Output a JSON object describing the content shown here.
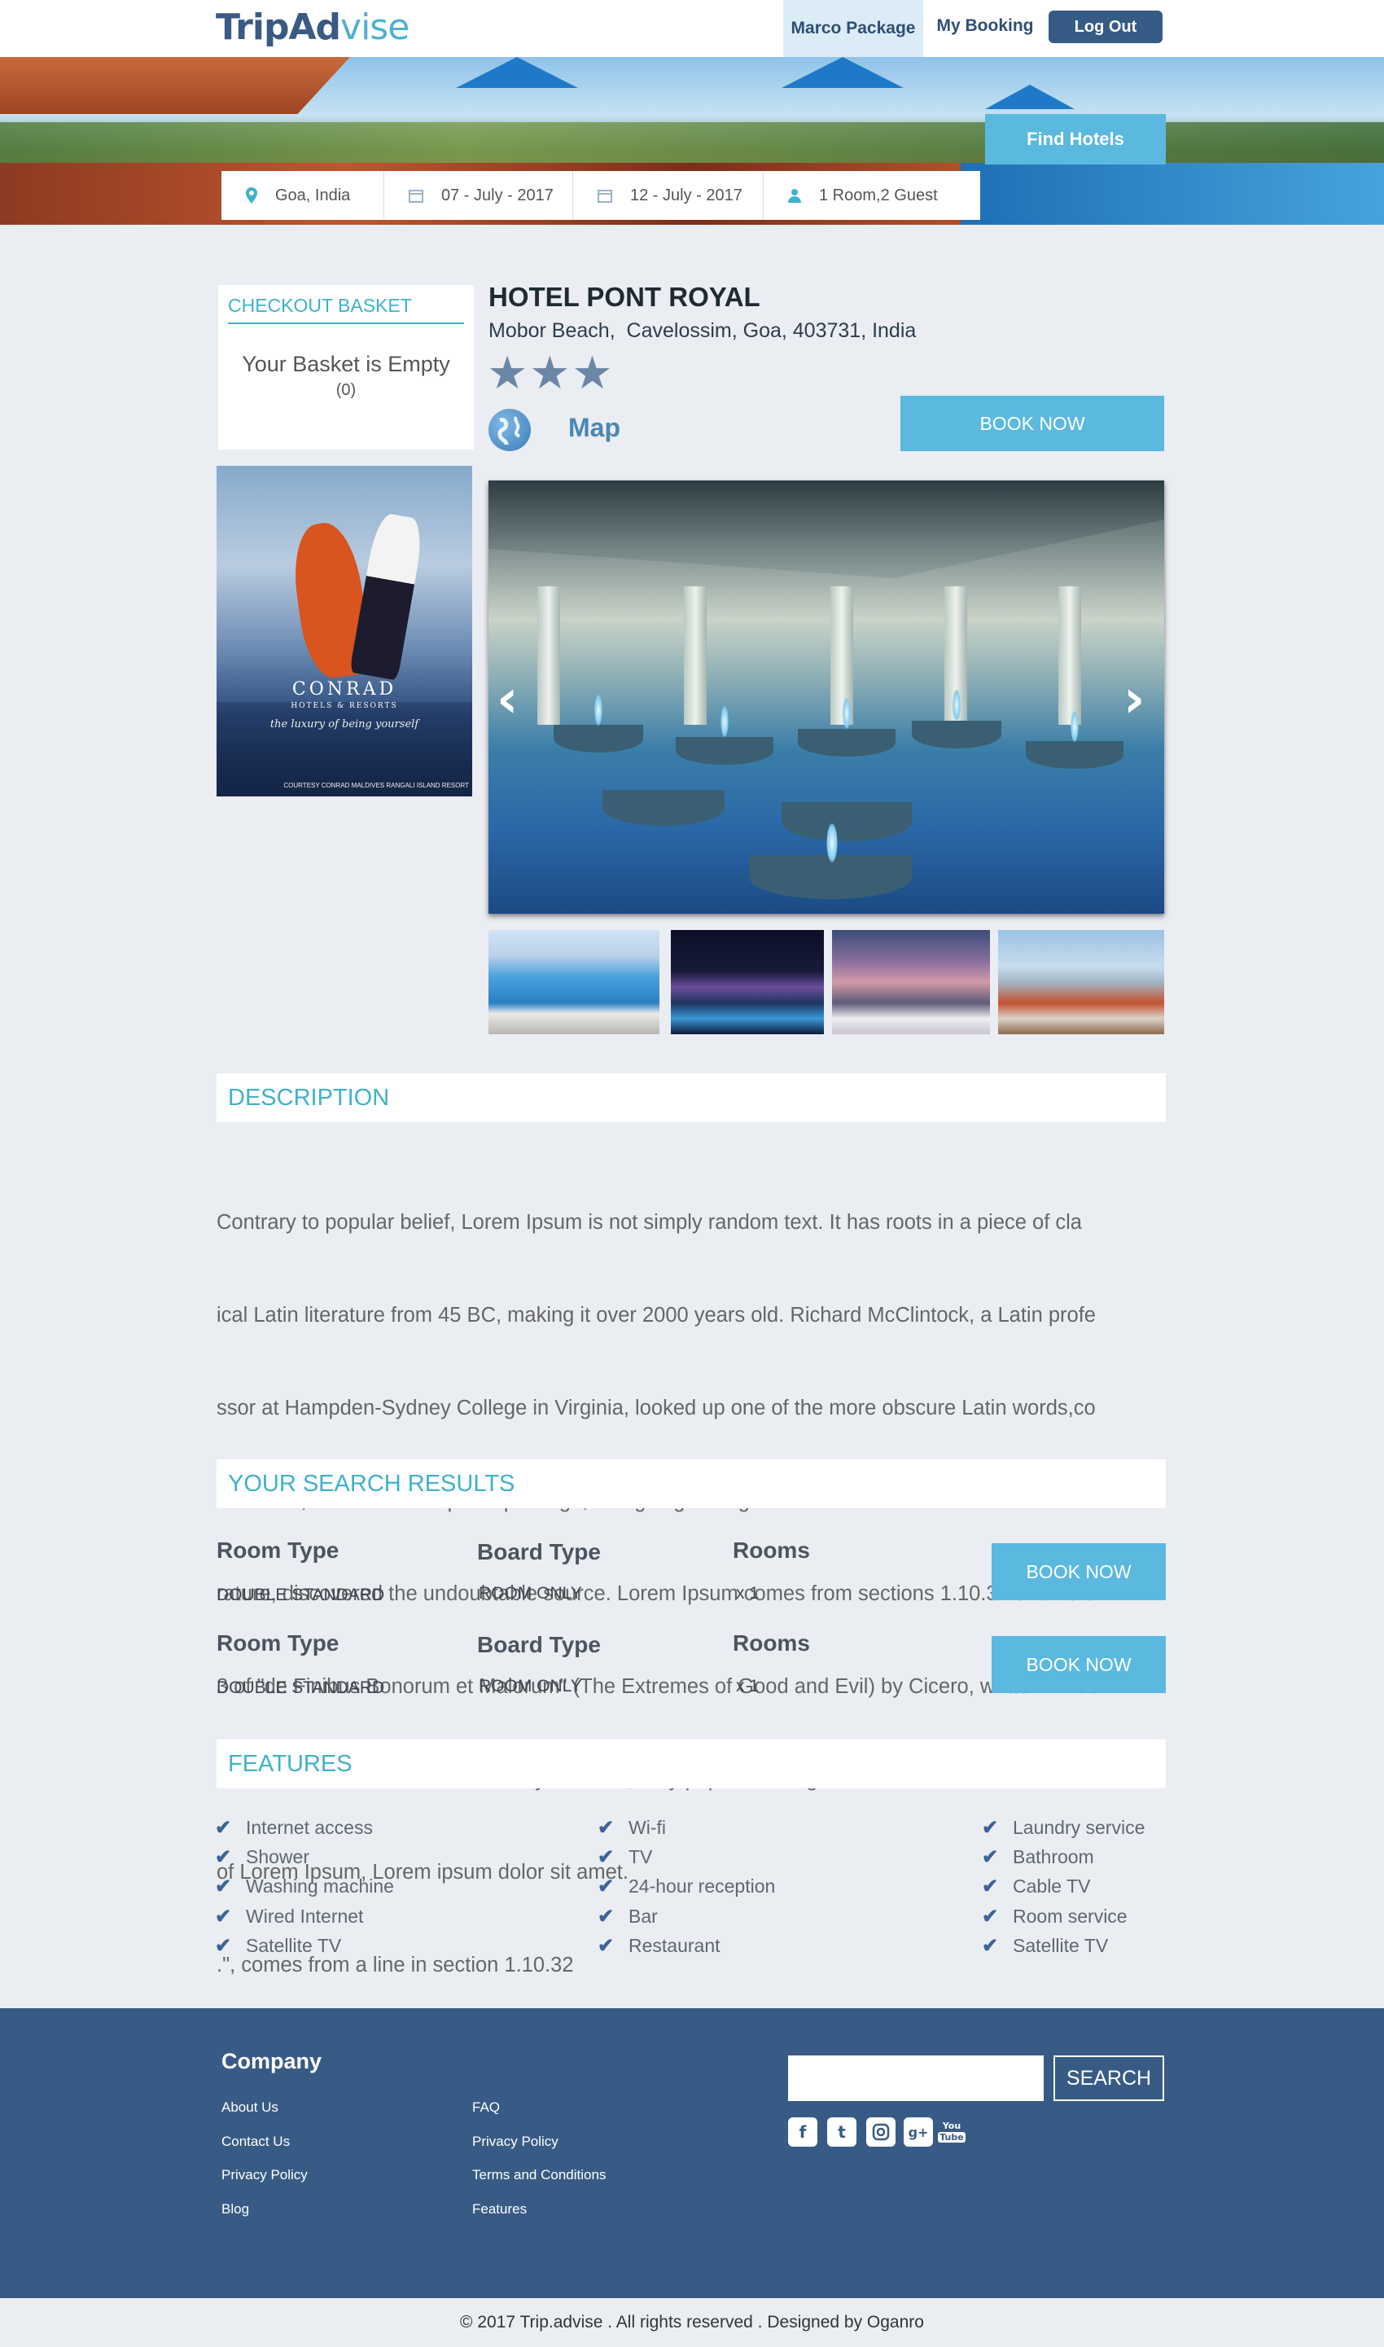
{
  "header": {
    "logo_part1": "TripAd",
    "logo_part2": "v",
    "logo_part3": "ise",
    "nav_marco": "Marco Package",
    "nav_booking": "My Booking",
    "nav_logout": "Log Out"
  },
  "search": {
    "location": "Goa, India",
    "checkin": "07 - July - 2017",
    "checkout": "12 - July - 2017",
    "guests": "1 Room,2 Guest",
    "button": "Find  Hotels"
  },
  "basket": {
    "title": "CHECKOUT BASKET",
    "empty": "Your Basket is Empty",
    "count": "(0)"
  },
  "promo": {
    "brand": "CONRAD",
    "sub": "HOTELS & RESORTS",
    "tagline": "the luxury of being yourself",
    "credit": "COURTESY CONRAD MALDIVES RANGALI ISLAND RESORT"
  },
  "hotel": {
    "name": "HOTEL PONT ROYAL",
    "address": "Mobor Beach,  Cavelossim, Goa, 403731, India",
    "stars": 3,
    "map_label": "Map",
    "book_label": "BOOK NOW"
  },
  "description": {
    "title": "DESCRIPTION",
    "lines": [
      "Contrary to popular belief, Lorem Ipsum is not simply random text. It has roots in a piece of cla",
      "ical Latin literature from 45 BC, making it over 2000 years old. Richard McClintock, a Latin profe",
      "ssor at Hampden-Sydney College in Virginia, looked up one of the more obscure Latin words,co",
      "nsectetur, from a Lorem Ipsum passage, and going through the cites of the word in classical lite",
      "rature, discovered the undoubtable source. Lorem Ipsum comes from sections 1.10.32 and 10.3",
      "3 of \"de Finibus Bonorum et Malorum\" (The Extremes of Good and Evil) by Cicero, writtenin 45C",
      "This book is a treatise on the theory of ethics, very popular during the Renaissance.The first line",
      "of Lorem Ipsum, Lorem ipsum dolor sit amet.",
      ".\", comes from a line in section 1.10.32"
    ]
  },
  "results": {
    "title": "YOUR SEARCH RESULTS",
    "col_room": "Room Type",
    "col_board": "Board Type",
    "col_rooms": "Rooms",
    "book_label": "BOOK NOW",
    "rows": [
      {
        "room": "DOUBLE STANDARD",
        "board": "ROOM ONLY",
        "qty": "x 1"
      },
      {
        "room": "DOUBLE STANDARD",
        "board": "ROOM ONLY",
        "qty": "x 1"
      }
    ]
  },
  "features": {
    "title": "FEATURES",
    "col1": [
      "Internet access",
      "Shower",
      "Washing machine",
      "Wired Internet",
      "Satellite TV"
    ],
    "col2": [
      "Wi-fi",
      "TV",
      "24-hour reception",
      "Bar",
      "Restaurant"
    ],
    "col3": [
      "Laundry service",
      "Bathroom",
      "Cable TV",
      "Room service",
      "Satellite TV"
    ]
  },
  "footer": {
    "company": "Company",
    "links1": [
      "About Us",
      "Contact Us",
      "Privacy Policy",
      "Blog"
    ],
    "links2": [
      "FAQ",
      "Privacy Policy",
      "Terms and Conditions",
      "Features"
    ],
    "search_label": "SEARCH",
    "social": [
      "facebook-icon",
      "twitter-icon",
      "instagram-icon",
      "google-plus-icon",
      "youtube-icon"
    ],
    "copyright": "© 2017 Trip.advise . All rights reserved . Designed by Oganro"
  },
  "colors": {
    "accent": "#5bb9e0",
    "heading_teal": "#3fb2c9",
    "navy": "#385b85",
    "background": "#eaedf2"
  }
}
